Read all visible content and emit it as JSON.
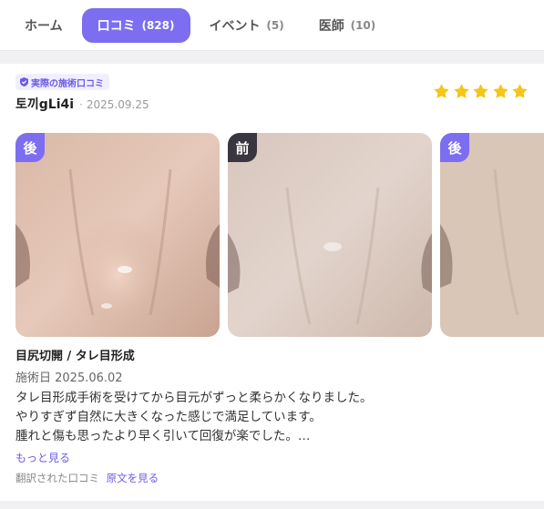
{
  "tabs": [
    {
      "label": "ホーム",
      "count": ""
    },
    {
      "label": "口コミ",
      "count": "(828)"
    },
    {
      "label": "イベント",
      "count": "(5)"
    },
    {
      "label": "医師",
      "count": "(10)"
    }
  ],
  "review": {
    "verified_label": "実際の施術口コミ",
    "username": "토끼gLi4i",
    "separator": "·",
    "date": "2025.09.25",
    "rating": 5,
    "photos": [
      {
        "tag": "後"
      },
      {
        "tag": "前"
      },
      {
        "tag": "後"
      }
    ],
    "procedure": "目尻切開 / タレ目形成",
    "procedure_date": "施術日 2025.06.02",
    "text_lines": [
      "タレ目形成手術を受けてから目元がずっと柔らかくなりました。",
      "やりすぎず自然に大きくなった感じで満足しています。",
      "腫れと傷も思ったより早く引いて回復が楽でした。…"
    ],
    "more_label": "もっと見る",
    "translated_label": "翻訳された口コミ",
    "original_link": "原文を見る"
  },
  "colors": {
    "accent": "#7d6df0",
    "star": "#f5c518",
    "before_tag": "#3a3640"
  }
}
